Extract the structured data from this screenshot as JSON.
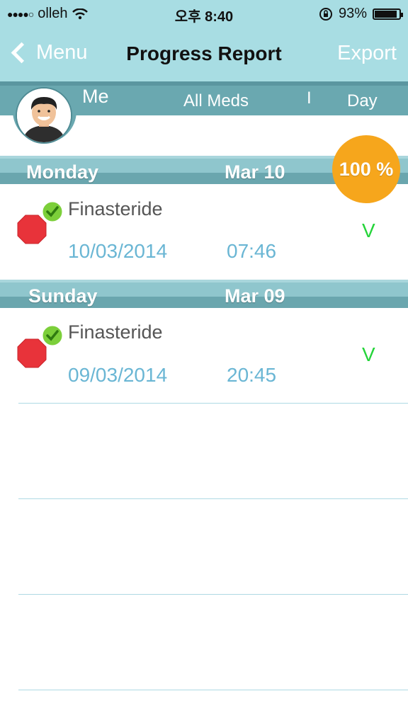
{
  "status_bar": {
    "carrier": "olleh",
    "time": "오후 8:40",
    "battery_text": "93%",
    "battery_level": 0.93
  },
  "nav": {
    "back_label": "Menu",
    "title": "Progress Report",
    "export_label": "Export"
  },
  "filters": {
    "user": "Me",
    "meds": "All Meds",
    "separator": "I",
    "period": "Day"
  },
  "summary": {
    "percent": "100 %"
  },
  "sections": [
    {
      "day": "Monday",
      "date": "Mar 10",
      "entries": [
        {
          "med": "Finasteride",
          "date": "10/03/2014",
          "time": "07:46",
          "mark": "V"
        }
      ]
    },
    {
      "day": "Sunday",
      "date": "Mar 09",
      "entries": [
        {
          "med": "Finasteride",
          "date": "09/03/2014",
          "time": "20:45",
          "mark": "V"
        }
      ]
    }
  ],
  "colors": {
    "header_bg": "#a8dde3",
    "filter_bg": "#6aa8b0",
    "badge": "#f6a61c",
    "date_text": "#6ab6d4",
    "check_mark": "#25d43a",
    "stop_red": "#e8333a"
  },
  "icons": {
    "back": "chevron-left-icon",
    "wifi": "wifi-icon",
    "lock": "rotation-lock-icon",
    "battery": "battery-icon",
    "stop": "stop-sign-icon",
    "check": "check-circle-icon"
  }
}
